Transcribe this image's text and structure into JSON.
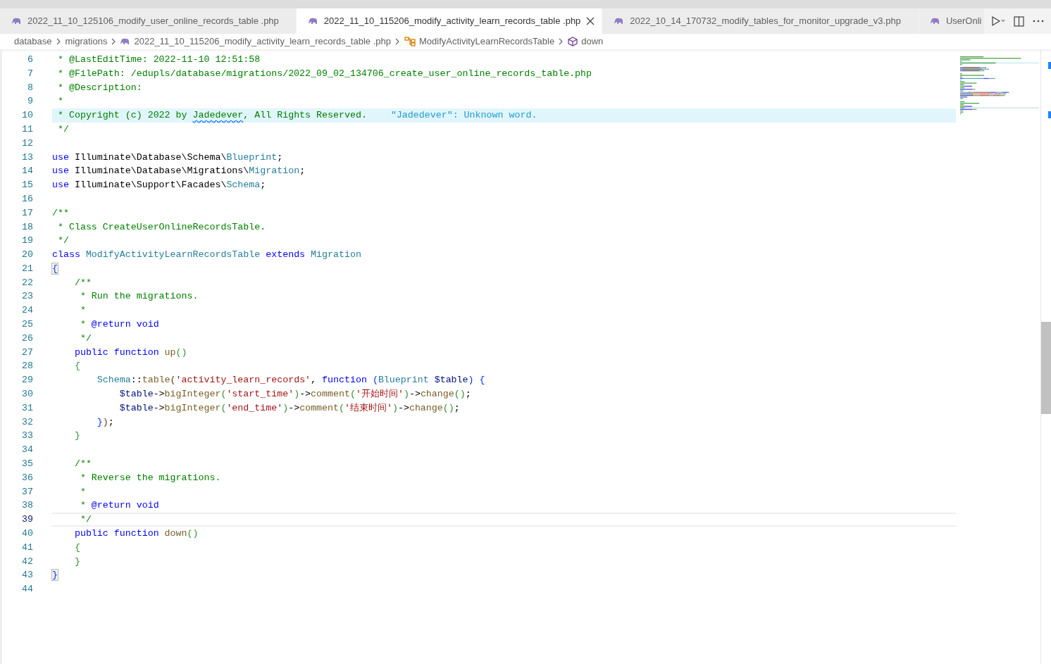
{
  "tabs": [
    {
      "label": "2022_11_10_125106_modify_user_online_records_table .php",
      "selected": false
    },
    {
      "label": "2022_11_10_115206_modify_activity_learn_records_table .php",
      "selected": true
    },
    {
      "label": "2022_10_14_170732_modify_tables_for_monitor_upgrade_v3.php",
      "selected": false
    },
    {
      "label": "UserOnli",
      "selected": false
    }
  ],
  "breadcrumb": [
    {
      "kind": "folder",
      "label": "database"
    },
    {
      "kind": "folder",
      "label": "migrations"
    },
    {
      "kind": "file",
      "label": "2022_11_10_115206_modify_activity_learn_records_table .php"
    },
    {
      "kind": "class",
      "label": "ModifyActivityLearnRecordsTable"
    },
    {
      "kind": "method",
      "label": "down"
    }
  ],
  "lines": [
    {
      "n": "6",
      "kind": "normal",
      "tokens": [
        {
          "kind": "comment",
          "t": " * @LastEditTime: 2022-11-10 12:51:58"
        }
      ]
    },
    {
      "n": "7",
      "kind": "normal",
      "tokens": [
        {
          "kind": "comment",
          "t": " * @FilePath: /edupls/database/migrations/2022_09_02_134706_create_user_online_records_table.php"
        }
      ]
    },
    {
      "n": "8",
      "kind": "normal",
      "tokens": [
        {
          "kind": "comment",
          "t": " * @Description:"
        }
      ]
    },
    {
      "n": "9",
      "kind": "normal",
      "tokens": [
        {
          "kind": "comment",
          "t": " *"
        }
      ]
    },
    {
      "n": "10",
      "kind": "diagnostic",
      "diagnostic": "\"Jadedever\": Unknown word.",
      "tokens": [
        {
          "kind": "comment",
          "t": " * Copyright (c) 2022 by "
        },
        {
          "kind": "misspelled",
          "t": "Jadedever"
        },
        {
          "kind": "comment",
          "t": ", All Rights Reserved."
        }
      ]
    },
    {
      "n": "11",
      "kind": "normal",
      "tokens": [
        {
          "kind": "comment",
          "t": " */"
        }
      ]
    },
    {
      "n": "12",
      "kind": "normal"
    },
    {
      "n": "13",
      "kind": "normal",
      "tokens": [
        {
          "kind": "keyword",
          "t": "use"
        },
        {
          "kind": "plain",
          "t": " Illuminate\\Database\\Schema\\"
        },
        {
          "kind": "type",
          "t": "Blueprint"
        },
        {
          "kind": "plain",
          "t": ";"
        }
      ]
    },
    {
      "n": "14",
      "kind": "normal",
      "tokens": [
        {
          "kind": "keyword",
          "t": "use"
        },
        {
          "kind": "plain",
          "t": " Illuminate\\Database\\Migrations\\"
        },
        {
          "kind": "type",
          "t": "Migration"
        },
        {
          "kind": "plain",
          "t": ";"
        }
      ]
    },
    {
      "n": "15",
      "kind": "normal",
      "tokens": [
        {
          "kind": "keyword",
          "t": "use"
        },
        {
          "kind": "plain",
          "t": " Illuminate\\Support\\Facades\\"
        },
        {
          "kind": "type",
          "t": "Schema"
        },
        {
          "kind": "plain",
          "t": ";"
        }
      ]
    },
    {
      "n": "16",
      "kind": "normal"
    },
    {
      "n": "17",
      "kind": "normal",
      "tokens": [
        {
          "kind": "comment",
          "t": "/**"
        }
      ]
    },
    {
      "n": "18",
      "kind": "normal",
      "tokens": [
        {
          "kind": "comment",
          "t": " * Class CreateUserOnlineRecordsTable."
        }
      ]
    },
    {
      "n": "19",
      "kind": "normal",
      "tokens": [
        {
          "kind": "comment",
          "t": " */"
        }
      ]
    },
    {
      "n": "20",
      "kind": "normal",
      "tokens": [
        {
          "kind": "keyword",
          "t": "class"
        },
        {
          "kind": "type",
          "t": " ModifyActivityLearnRecordsTable"
        },
        {
          "kind": "keyword",
          "t": " extends"
        },
        {
          "kind": "type",
          "t": " Migration"
        }
      ]
    },
    {
      "n": "21",
      "kind": "normal",
      "tokens": [
        {
          "kind": "bracket-match",
          "t": "{"
        }
      ]
    },
    {
      "n": "22",
      "kind": "normal",
      "tokens": [
        {
          "kind": "comment",
          "t": "    /**"
        }
      ]
    },
    {
      "n": "23",
      "kind": "normal",
      "tokens": [
        {
          "kind": "comment",
          "t": "     * Run the migrations."
        }
      ]
    },
    {
      "n": "24",
      "kind": "normal",
      "tokens": [
        {
          "kind": "comment",
          "t": "     *"
        }
      ]
    },
    {
      "n": "25",
      "kind": "normal",
      "tokens": [
        {
          "kind": "comment",
          "t": "     *"
        },
        {
          "kind": "keyword",
          "t": " @return void"
        }
      ]
    },
    {
      "n": "26",
      "kind": "normal",
      "tokens": [
        {
          "kind": "comment",
          "t": "     */"
        }
      ]
    },
    {
      "n": "27",
      "kind": "normal",
      "tokens": [
        {
          "kind": "keyword",
          "t": "    public function"
        },
        {
          "kind": "function",
          "t": " up"
        },
        {
          "kind": "bracket2",
          "t": "()"
        }
      ]
    },
    {
      "n": "28",
      "kind": "normal",
      "tokens": [
        {
          "kind": "bracket2",
          "t": "    {"
        }
      ]
    },
    {
      "n": "29",
      "kind": "normal",
      "tokens": [
        {
          "kind": "type",
          "t": "        Schema"
        },
        {
          "kind": "plain",
          "t": "::"
        },
        {
          "kind": "function",
          "t": "table"
        },
        {
          "kind": "bracket3",
          "t": "("
        },
        {
          "kind": "string",
          "t": "'activity_learn_records'"
        },
        {
          "kind": "plain",
          "t": ","
        },
        {
          "kind": "keyword",
          "t": " function"
        },
        {
          "kind": "bracket1",
          "t": " ("
        },
        {
          "kind": "type",
          "t": "Blueprint"
        },
        {
          "kind": "variable",
          "t": " $table"
        },
        {
          "kind": "bracket1",
          "t": ") {"
        }
      ]
    },
    {
      "n": "30",
      "kind": "normal",
      "tokens": [
        {
          "kind": "variable",
          "t": "            $table"
        },
        {
          "kind": "plain",
          "t": "->"
        },
        {
          "kind": "function",
          "t": "bigInteger"
        },
        {
          "kind": "bracket2",
          "t": "("
        },
        {
          "kind": "string",
          "t": "'start_time'"
        },
        {
          "kind": "bracket2",
          "t": ")"
        },
        {
          "kind": "plain",
          "t": "->"
        },
        {
          "kind": "function",
          "t": "comment"
        },
        {
          "kind": "bracket2",
          "t": "("
        },
        {
          "kind": "string",
          "t": "'开始时间'"
        },
        {
          "kind": "bracket2",
          "t": ")"
        },
        {
          "kind": "plain",
          "t": "->"
        },
        {
          "kind": "function",
          "t": "change"
        },
        {
          "kind": "bracket2",
          "t": "()"
        },
        {
          "kind": "plain",
          "t": ";"
        }
      ]
    },
    {
      "n": "31",
      "kind": "normal",
      "tokens": [
        {
          "kind": "variable",
          "t": "            $table"
        },
        {
          "kind": "plain",
          "t": "->"
        },
        {
          "kind": "function",
          "t": "bigInteger"
        },
        {
          "kind": "bracket2",
          "t": "("
        },
        {
          "kind": "string",
          "t": "'end_time'"
        },
        {
          "kind": "bracket2",
          "t": ")"
        },
        {
          "kind": "plain",
          "t": "->"
        },
        {
          "kind": "function",
          "t": "comment"
        },
        {
          "kind": "bracket2",
          "t": "("
        },
        {
          "kind": "string",
          "t": "'结束时间'"
        },
        {
          "kind": "bracket2",
          "t": ")"
        },
        {
          "kind": "plain",
          "t": "->"
        },
        {
          "kind": "function",
          "t": "change"
        },
        {
          "kind": "bracket2",
          "t": "()"
        },
        {
          "kind": "plain",
          "t": ";"
        }
      ]
    },
    {
      "n": "32",
      "kind": "normal",
      "tokens": [
        {
          "kind": "bracket1",
          "t": "        }"
        },
        {
          "kind": "bracket3",
          "t": ")"
        },
        {
          "kind": "plain",
          "t": ";"
        }
      ]
    },
    {
      "n": "33",
      "kind": "normal",
      "tokens": [
        {
          "kind": "bracket2",
          "t": "    }"
        }
      ]
    },
    {
      "n": "34",
      "kind": "normal"
    },
    {
      "n": "35",
      "kind": "normal",
      "tokens": [
        {
          "kind": "comment",
          "t": "    /**"
        }
      ]
    },
    {
      "n": "36",
      "kind": "normal",
      "tokens": [
        {
          "kind": "comment",
          "t": "     * Reverse the migrations."
        }
      ]
    },
    {
      "n": "37",
      "kind": "normal",
      "tokens": [
        {
          "kind": "comment",
          "t": "     *"
        }
      ]
    },
    {
      "n": "38",
      "kind": "normal",
      "tokens": [
        {
          "kind": "comment",
          "t": "     *"
        },
        {
          "kind": "keyword",
          "t": " @return void"
        }
      ]
    },
    {
      "n": "39",
      "kind": "cursor",
      "tokens": [
        {
          "kind": "comment",
          "t": "     */"
        }
      ]
    },
    {
      "n": "40",
      "kind": "normal",
      "tokens": [
        {
          "kind": "keyword",
          "t": "    public function"
        },
        {
          "kind": "function",
          "t": " down"
        },
        {
          "kind": "bracket2",
          "t": "()"
        }
      ]
    },
    {
      "n": "41",
      "kind": "normal",
      "tokens": [
        {
          "kind": "bracket2",
          "t": "    {"
        }
      ]
    },
    {
      "n": "42",
      "kind": "normal",
      "tokens": [
        {
          "kind": "bracket2",
          "t": "    }"
        }
      ]
    },
    {
      "n": "43",
      "kind": "normal",
      "tokens": [
        {
          "kind": "bracket-match",
          "t": "}"
        }
      ]
    },
    {
      "n": "44",
      "kind": "normal"
    }
  ]
}
